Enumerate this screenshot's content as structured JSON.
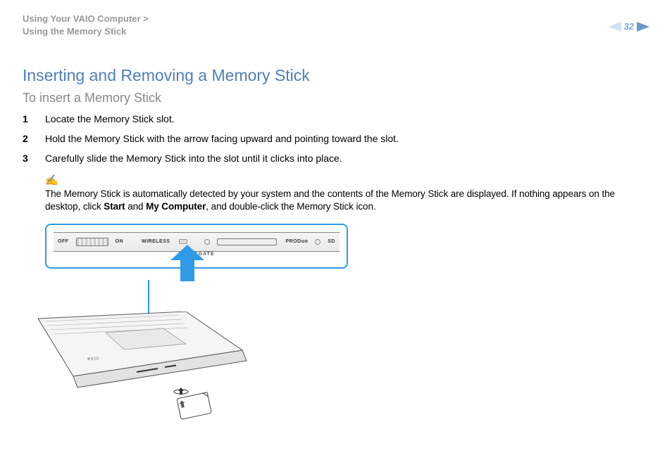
{
  "breadcrumb": {
    "line1": "Using Your VAIO Computer >",
    "line2": "Using the Memory Stick"
  },
  "page_number": "32",
  "title": "Inserting and Removing a Memory Stick",
  "subtitle": "To insert a Memory Stick",
  "steps": [
    "Locate the Memory Stick slot.",
    "Hold the Memory Stick with the arrow facing upward and pointing toward the slot.",
    "Carefully slide the Memory Stick into the slot until it clicks into place."
  ],
  "note": {
    "icon": "✍",
    "text_before": "The Memory Stick is automatically detected by your system and the contents of the Memory Stick are displayed. If nothing appears on the desktop, click ",
    "bold1": "Start",
    "mid": " and ",
    "bold2": "My Computer",
    "text_after": ", and double-click the Memory Stick icon."
  },
  "diagram": {
    "labels": {
      "wireless": "WIRELESS",
      "off": "OFF",
      "on": "ON",
      "produo": "PRODuo",
      "sd": "SD",
      "magicgate": "MAGICGATE"
    }
  }
}
